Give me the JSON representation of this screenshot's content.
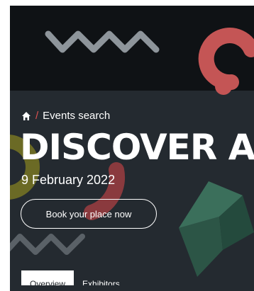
{
  "breadcrumb": {
    "home_icon": "home-icon",
    "separator": "/",
    "current": "Events search"
  },
  "hero": {
    "title": "DISCOVER A",
    "date": "9 February 2022",
    "cta_label": "Book your place now"
  },
  "tabs": [
    {
      "label": "Overview",
      "active": true
    },
    {
      "label": "Exhibitors",
      "active": false
    }
  ],
  "colors": {
    "hero_background": "#242a30",
    "hero_top_band": "#0f1215",
    "accent_red": "#e05252",
    "olive_shape": "#6b6a25",
    "green_shape": "#2d5a4a",
    "zigzag_grey": "#8e959b"
  }
}
